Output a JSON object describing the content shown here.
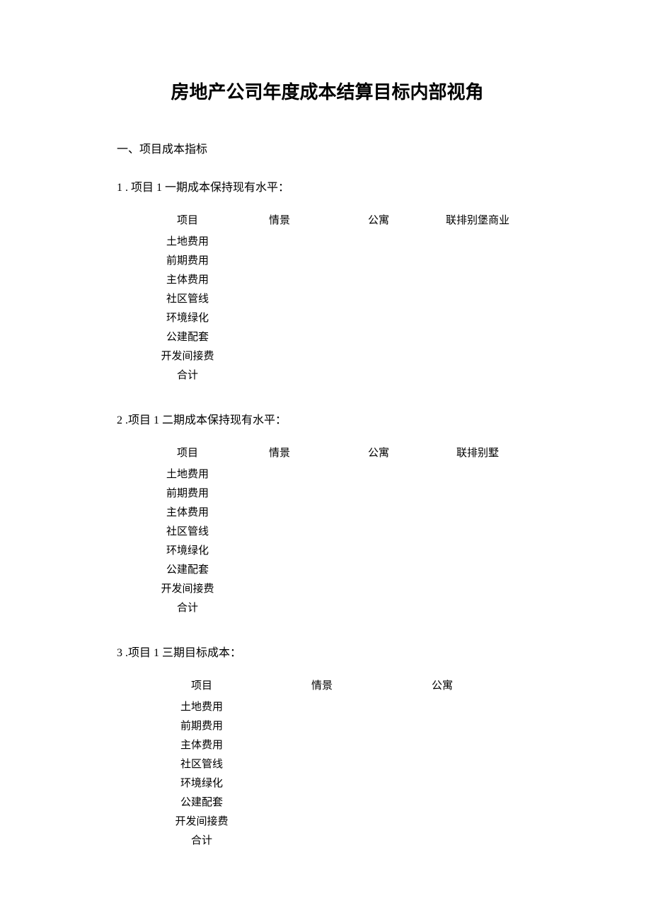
{
  "title": "房地产公司年度成本结算目标内部视角",
  "section1": {
    "heading": "一、项目成本指标",
    "sub1": {
      "num": "1",
      "text": " . 项目 1 一期成本保持现有水平：",
      "table": {
        "headers": {
          "item": "项目",
          "scenario": "情景",
          "apt": "公寓",
          "last": "联排别堡商业"
        },
        "rows": [
          "土地费用",
          "前期费用",
          "主体费用",
          "社区管线",
          "环境绿化",
          "公建配套",
          "开发间接费",
          "合计"
        ]
      }
    },
    "sub2": {
      "num": "2",
      "text": "  .项目 1 二期成本保持现有水平：",
      "table": {
        "headers": {
          "item": "项目",
          "scenario": "情景",
          "apt": "公寓",
          "last": "联排别墅"
        },
        "rows": [
          "土地费用",
          "前期费用",
          "主体费用",
          "社区管线",
          "环境绿化",
          "公建配套",
          "开发间接费",
          "合计"
        ]
      }
    },
    "sub3": {
      "num": "3",
      "text": "  .项目 1 三期目标成本：",
      "table": {
        "headers": {
          "item": "项目",
          "scenario": "情景",
          "apt": "公寓"
        },
        "rows": [
          "土地费用",
          "前期费用",
          "主体费用",
          "社区管线",
          "环境绿化",
          "公建配套",
          "开发间接费",
          "合计"
        ]
      }
    }
  }
}
